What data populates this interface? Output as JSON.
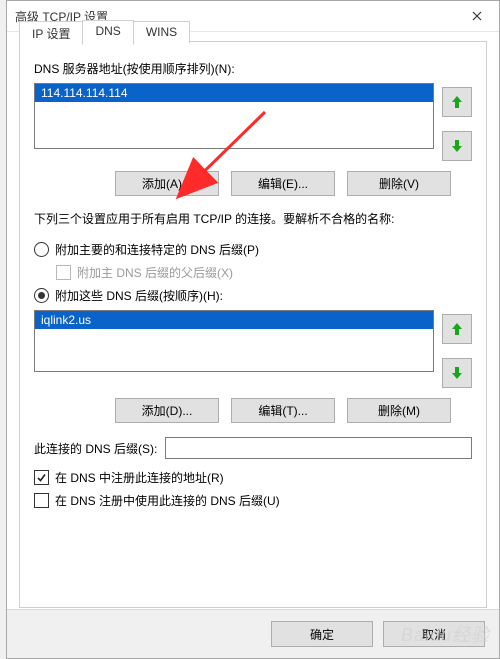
{
  "window": {
    "title": "高级 TCP/IP 设置"
  },
  "tabs": {
    "ip": "IP 设置",
    "dns": "DNS",
    "wins": "WINS"
  },
  "dns": {
    "servers_label": "DNS 服务器地址(按使用顺序排列)(N):",
    "servers": [
      "114.114.114.114"
    ],
    "btn_add_a": "添加(A)...",
    "btn_edit_e": "编辑(E)...",
    "btn_delete_v": "删除(V)",
    "paragraph": "下列三个设置应用于所有启用 TCP/IP 的连接。要解析不合格的名称:",
    "radio_primary": "附加主要的和连接特定的 DNS 后缀(P)",
    "check_parent": "附加主 DNS 后缀的父后缀(X)",
    "radio_these": "附加这些 DNS 后缀(按顺序)(H):",
    "suffixes": [
      "iqlink2.us"
    ],
    "btn_add_d": "添加(D)...",
    "btn_edit_t": "编辑(T)...",
    "btn_delete_m": "删除(M)",
    "conn_suffix_label": "此连接的 DNS 后缀(S):",
    "conn_suffix_value": "",
    "check_register": "在 DNS 中注册此连接的地址(R)",
    "check_use_suffix": "在 DNS 注册中使用此连接的 DNS 后缀(U)"
  },
  "footer": {
    "ok": "确定",
    "cancel": "取消"
  },
  "watermark": "Baidu经验",
  "annotation": {
    "arrow_color": "#ff2a2a"
  }
}
